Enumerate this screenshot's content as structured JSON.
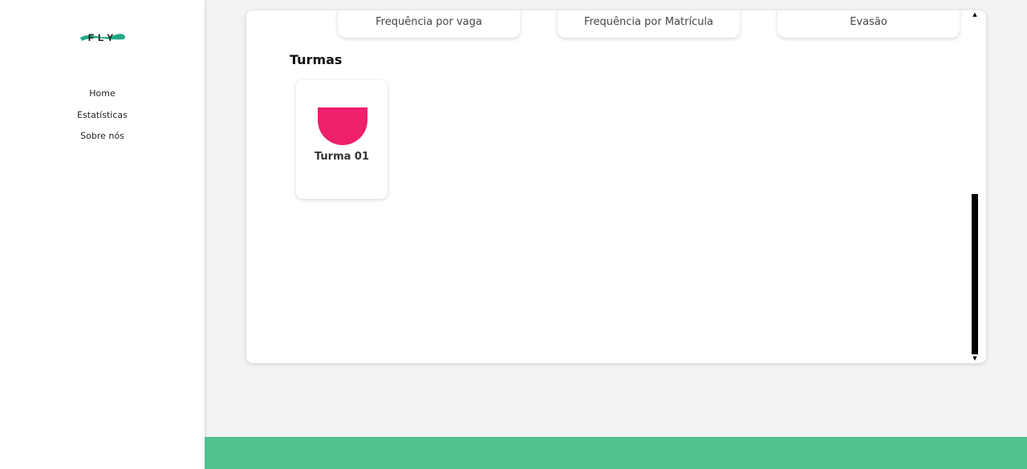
{
  "brand": {
    "logo_text": "FLY",
    "logo_color": "#1faa84"
  },
  "sidebar": {
    "items": [
      {
        "label": "Home"
      },
      {
        "label": "Estatísticas"
      },
      {
        "label": "Sobre nós"
      }
    ]
  },
  "stats": {
    "tabs": [
      {
        "label": "Frequência por vaga"
      },
      {
        "label": "Frequência por Matrícula"
      },
      {
        "label": "Evasão"
      }
    ]
  },
  "turmas": {
    "title": "Turmas",
    "items": [
      {
        "label": "Turma 01",
        "icon": "semicircle-icon",
        "icon_color": "#ee1f6b"
      }
    ]
  },
  "colors": {
    "footer": "#50c18f",
    "background": "#f3f3f3"
  },
  "icons": {
    "scroll_up": "▲",
    "scroll_down": "▼"
  }
}
